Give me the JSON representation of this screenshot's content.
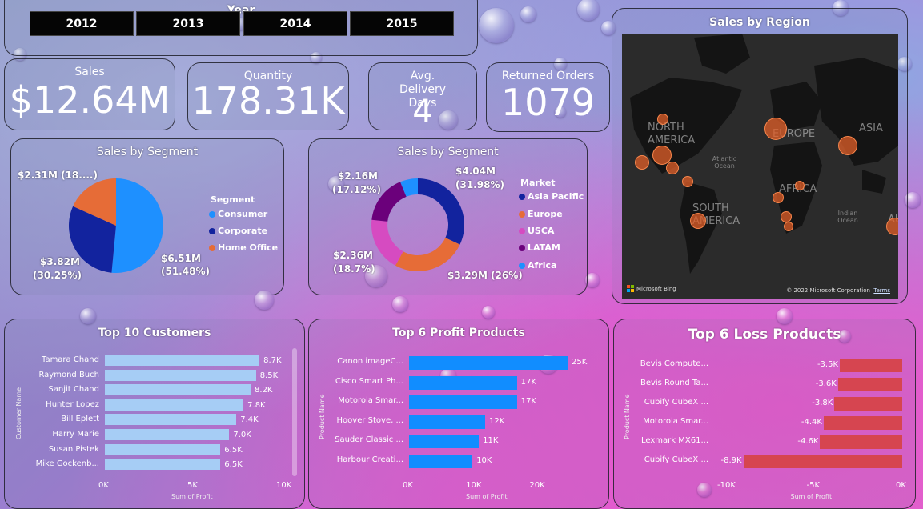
{
  "year_filter": {
    "title": "Year",
    "years": [
      "2012",
      "2013",
      "2014",
      "2015"
    ]
  },
  "kpis": {
    "sales": {
      "label": "Sales",
      "value": "$12.64M"
    },
    "quantity": {
      "label": "Quantity",
      "value": "178.31K"
    },
    "delivery": {
      "label": "Avg. Delivery Days",
      "value": "4"
    },
    "returns": {
      "label": "Returned Orders",
      "value": "1079"
    }
  },
  "segment_chart": {
    "title": "Sales by Segment",
    "legend_title": "Segment",
    "legend": [
      "Consumer",
      "Corporate",
      "Home Office"
    ],
    "labels": {
      "home_office": "$2.31M (18....)",
      "corporate_value": "$3.82M",
      "corporate_pct": "(30.25%)",
      "consumer_value": "$6.51M",
      "consumer_pct": "(51.48%)"
    }
  },
  "market_chart": {
    "title": "Sales by Segment",
    "legend_title": "Market",
    "legend": [
      "Asia Pacific",
      "Europe",
      "USCA",
      "LATAM",
      "Africa"
    ],
    "labels": {
      "latam_value": "$2.16M",
      "latam_pct": "(17.12%)",
      "asia_value": "$4.04M",
      "asia_pct": "(31.98%)",
      "usca_value": "$2.36M",
      "usca_pct": "(18.7%)",
      "europe": "$3.29M (26%)"
    }
  },
  "map": {
    "title": "Sales by Region",
    "labels": {
      "north_america": "NORTH AMERICA",
      "south_america": "SOUTH AMERICA",
      "europe": "EUROPE",
      "asia": "ASIA",
      "africa": "AFRICA",
      "atlantic": "Atlantic Ocean",
      "indian": "Indian Ocean",
      "au": "AU"
    },
    "attribution": "Microsoft Bing",
    "copyright": "© 2022 Microsoft Corporation",
    "terms": "Terms"
  },
  "chart_data": [
    {
      "type": "pie",
      "title": "Sales by Segment",
      "legend_title": "Segment",
      "categories": [
        "Consumer",
        "Corporate",
        "Home Office"
      ],
      "values": [
        6.51,
        3.82,
        2.31
      ],
      "percent": [
        51.48,
        30.25,
        18.27
      ],
      "colors": [
        "#1e90ff",
        "#12239e",
        "#e66c37"
      ]
    },
    {
      "type": "pie",
      "subtype": "donut",
      "title": "Sales by Segment",
      "legend_title": "Market",
      "categories": [
        "Asia Pacific",
        "Europe",
        "USCA",
        "LATAM",
        "Africa"
      ],
      "values": [
        4.04,
        3.29,
        2.36,
        2.16,
        0.78
      ],
      "percent": [
        31.98,
        26.0,
        18.7,
        17.12,
        6.2
      ],
      "colors": [
        "#12239e",
        "#e66c37",
        "#d64bc1",
        "#6b007b",
        "#1e90ff"
      ]
    },
    {
      "type": "bar",
      "orientation": "horizontal",
      "title": "Top 10 Customers",
      "xlabel": "Sum of Profit",
      "ylabel": "Customer Name",
      "categories": [
        "Tamara Chand",
        "Raymond Buch",
        "Sanjit Chand",
        "Hunter Lopez",
        "Bill Eplett",
        "Harry Marie",
        "Susan Pistek",
        "Mike Gockenb..."
      ],
      "values": [
        8.7,
        8.5,
        8.2,
        7.8,
        7.4,
        7.0,
        6.5,
        6.5
      ],
      "value_labels": [
        "8.7K",
        "8.5K",
        "8.2K",
        "7.8K",
        "7.4K",
        "7.0K",
        "6.5K",
        "6.5K"
      ],
      "xticks": [
        "0K",
        "5K",
        "10K"
      ],
      "xlim": [
        0,
        10
      ],
      "color": "#a6cdf5"
    },
    {
      "type": "bar",
      "orientation": "horizontal",
      "title": "Top 6 Profit Products",
      "xlabel": "Sum of Profit",
      "ylabel": "Product Name",
      "categories": [
        "Canon imageC...",
        "Cisco Smart Ph...",
        "Motorola Smar...",
        "Hoover Stove, ...",
        "Sauder Classic ...",
        "Harbour Creati..."
      ],
      "values": [
        25,
        17,
        17,
        12,
        11,
        10
      ],
      "value_labels": [
        "25K",
        "17K",
        "17K",
        "12K",
        "11K",
        "10K"
      ],
      "xticks": [
        "0K",
        "10K",
        "20K"
      ],
      "xlim": [
        0,
        25
      ],
      "color": "#118dff"
    },
    {
      "type": "bar",
      "orientation": "horizontal",
      "title": "Top 6 Loss Products",
      "xlabel": "Sum of Profit",
      "ylabel": "Product Name",
      "categories": [
        "Bevis Compute...",
        "Bevis Round Ta...",
        "Cubify CubeX ...",
        "Motorola Smar...",
        "Lexmark MX61...",
        "Cubify CubeX ..."
      ],
      "values": [
        -3.5,
        -3.6,
        -3.8,
        -4.4,
        -4.6,
        -8.9
      ],
      "value_labels": [
        "-3.5K",
        "-3.6K",
        "-3.8K",
        "-4.4K",
        "-4.6K",
        "-8.9K"
      ],
      "xticks": [
        "-10K",
        "-5K",
        "0K"
      ],
      "xlim": [
        -10,
        0
      ],
      "color": "#d64550"
    }
  ]
}
